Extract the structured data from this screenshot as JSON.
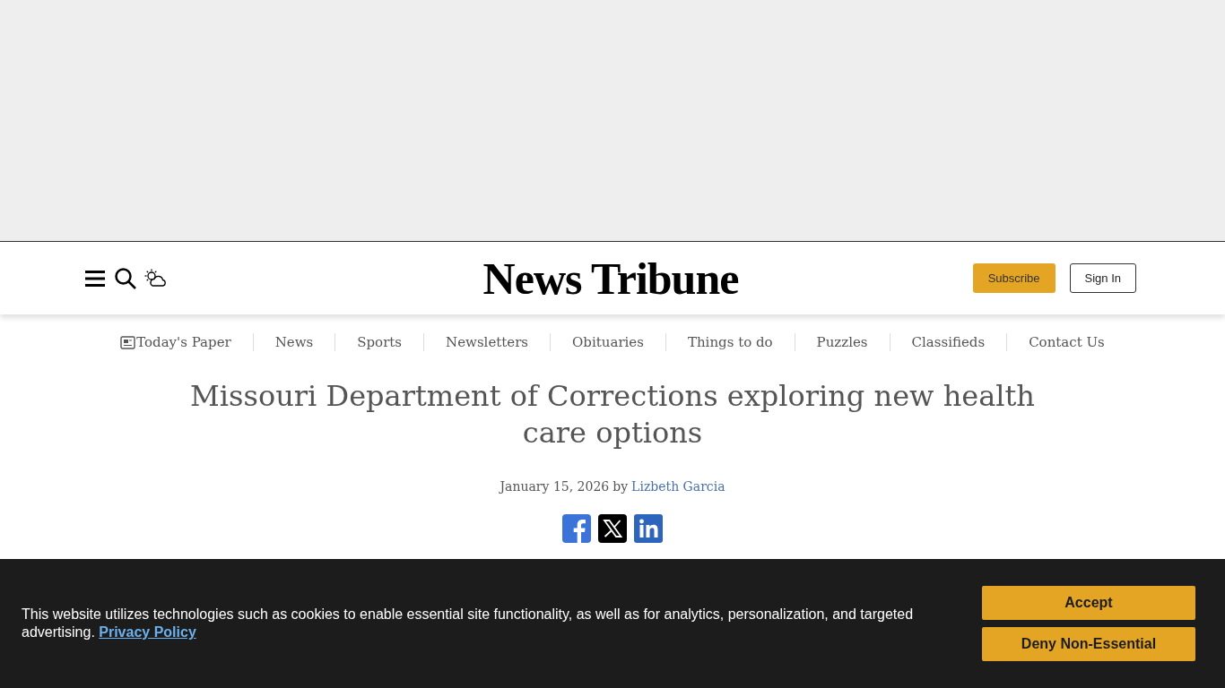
{
  "header": {
    "logo": "News Tribune",
    "subscribe": "Subscribe",
    "sign_in": "Sign In"
  },
  "nav": [
    {
      "label": "Today's Paper",
      "kind": "paper"
    },
    {
      "label": "News",
      "kind": "link"
    },
    {
      "label": "Sports",
      "kind": "link"
    },
    {
      "label": "Newsletters",
      "kind": "link"
    },
    {
      "label": "Obituaries",
      "kind": "link"
    },
    {
      "label": "Things to do",
      "kind": "link"
    },
    {
      "label": "Puzzles",
      "kind": "link"
    },
    {
      "label": "Classifieds",
      "kind": "link"
    },
    {
      "label": "Contact Us",
      "kind": "link"
    }
  ],
  "article": {
    "headline": "Missouri Department of Corrections exploring new health care options",
    "date": "January 15, 2026",
    "by": "by",
    "author": "Lizbeth Garcia"
  },
  "share": [
    {
      "kind": "facebook"
    },
    {
      "kind": "x"
    },
    {
      "kind": "linkedin"
    }
  ],
  "cookie_banner": {
    "text": "This website utilizes technologies such as cookies to enable essential site functionality, as well as for analytics, personalization, and targeted advertising.",
    "link": "Privacy Policy",
    "accept": "Accept",
    "deny": "Deny Non-Essential"
  }
}
